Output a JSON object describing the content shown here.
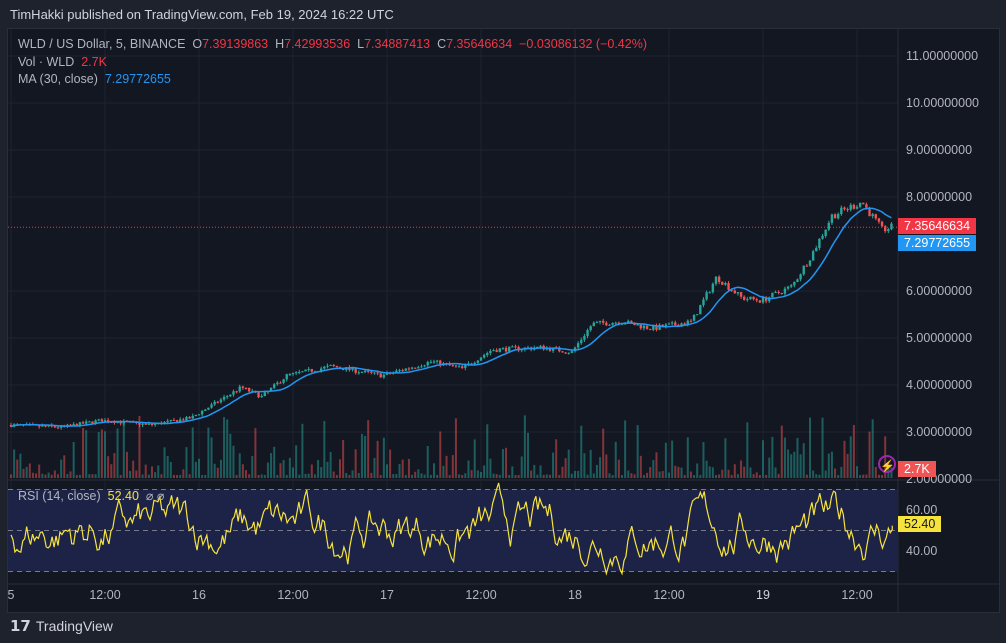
{
  "header": {
    "published": "TimHakki published on TradingView.com, Feb 19, 2024 16:22 UTC"
  },
  "legend": {
    "symbol": "WLD / US Dollar, 5, BINANCE",
    "o_label": "O",
    "o": "7.39139863",
    "h_label": "H",
    "h": "7.42993536",
    "l_label": "L",
    "l": "7.34887413",
    "c_label": "C",
    "c": "7.35646634",
    "change": "−0.03086132 (−0.42%)",
    "vol_label": "Vol · WLD",
    "vol": "2.7K",
    "ma_label": "MA (30, close)",
    "ma": "7.29772655",
    "rsi_label": "RSI (14, close)",
    "rsi": "52.40",
    "rsi_extra": "⌀ ⌀"
  },
  "price_tags": {
    "last": "7.35646634",
    "ma": "7.29772655",
    "vol": "2.7K",
    "rsi": "52.40"
  },
  "brand": "TradingView",
  "colors": {
    "up": "#26a69a",
    "down": "#ef5350",
    "ma": "#2196f3",
    "rsi": "#f7e33d",
    "bg": "#131722"
  },
  "chart_data": {
    "type": "line",
    "title": "WLD / US Dollar, 5, BINANCE",
    "price_axis": {
      "ticks": [
        "11.00000000",
        "10.00000000",
        "9.00000000",
        "8.00000000",
        "6.00000000",
        "5.00000000",
        "4.00000000",
        "3.00000000",
        "2.00000000"
      ],
      "tick_values": [
        11,
        10,
        9,
        8,
        6,
        5,
        4,
        3,
        2
      ],
      "range": [
        2,
        11.5
      ]
    },
    "time_axis": {
      "ticks": [
        "5",
        "12:00",
        "16",
        "12:00",
        "17",
        "12:00",
        "18",
        "12:00",
        "19",
        "12:00"
      ],
      "tick_hours": [
        0,
        12,
        24,
        36,
        48,
        60,
        72,
        84,
        96,
        108
      ]
    },
    "series": [
      {
        "name": "close",
        "hours": [
          0,
          6.4,
          11.5,
          17.9,
          23,
          29.4,
          32,
          35.2,
          40.9,
          47.4,
          53.7,
          57.6,
          61.4,
          67.8,
          71.6,
          74.2,
          78,
          81.8,
          86.9,
          90.1,
          93.3,
          95.9,
          99.7,
          102.3,
          104.8,
          108.6,
          111.2,
          112.5
        ],
        "values": [
          3.15,
          3.1,
          3.25,
          3.15,
          3.3,
          3.95,
          3.75,
          4.2,
          4.4,
          4.2,
          4.5,
          4.35,
          4.75,
          4.8,
          4.7,
          5.3,
          5.35,
          5.2,
          5.35,
          6.3,
          5.85,
          5.8,
          6.1,
          6.8,
          7.6,
          7.9,
          7.3,
          7.36
        ]
      }
    ],
    "last_price": 7.35646634,
    "ma_last": 7.29772655,
    "rsi": {
      "levels": [
        "60.00",
        "40.00"
      ],
      "level_values": [
        60,
        40
      ],
      "bands": [
        70,
        30
      ],
      "last": 52.4,
      "range": [
        28,
        75
      ]
    }
  }
}
